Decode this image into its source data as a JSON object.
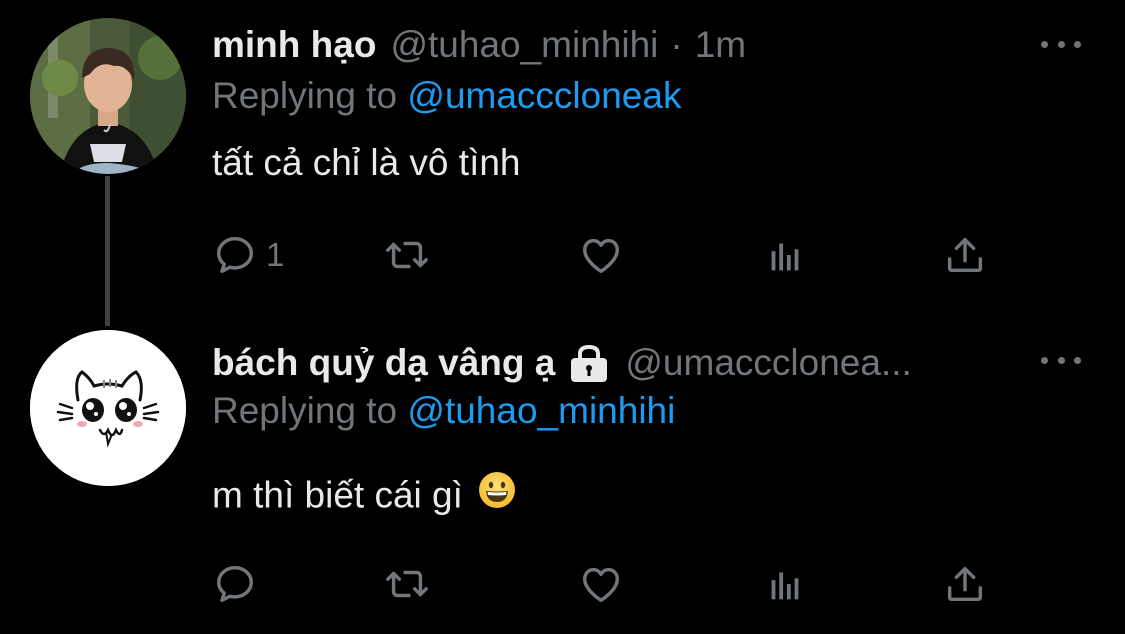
{
  "tweets": [
    {
      "author_name": "minh hạo",
      "author_handle": "@tuhao_minhihi",
      "separator": "·",
      "time": "1m",
      "replying_prefix": "Replying to",
      "replying_to": "@umacccloneak",
      "text": "tất cả chỉ là vô tình",
      "reply_count": "1",
      "avatar_icon": "profile-photo-young-man"
    },
    {
      "author_name": "bách quỷ dạ vâng ạ",
      "locked": true,
      "author_handle": "@umacccloneа...",
      "replying_prefix": "Replying to",
      "replying_to": "@tuhao_minhihi",
      "text": "m thì biết cái gì",
      "emoji": "grinning-face",
      "avatar_icon": "cat-doodle"
    }
  ],
  "colors": {
    "background": "#000000",
    "primary_text": "#e7e9ea",
    "secondary_text": "#71767b",
    "link": "#1d9bf0",
    "thread_line": "#3e4144"
  }
}
